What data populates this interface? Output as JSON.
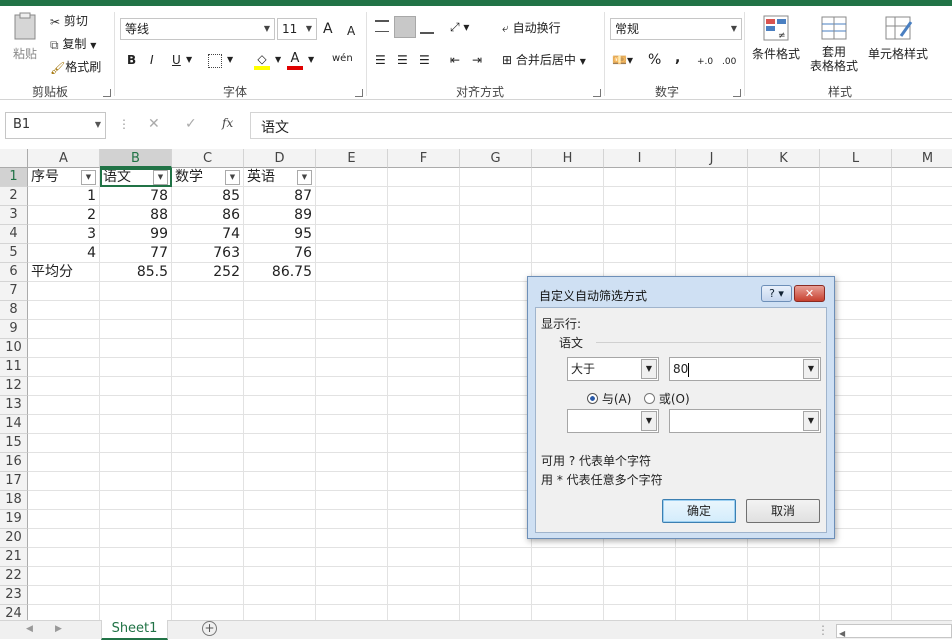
{
  "ribbon": {
    "clipboard": {
      "paste": "粘贴",
      "cut": "剪切",
      "copy": "复制",
      "format_painter": "格式刷",
      "group": "剪贴板"
    },
    "font": {
      "name": "等线",
      "size": "11",
      "bold": "B",
      "italic": "I",
      "underline": "U",
      "group": "字体",
      "grow": "A",
      "shrink": "A",
      "phonetic": "wén"
    },
    "alignment": {
      "wrap": "自动换行",
      "merge": "合并后居中",
      "group": "对齐方式"
    },
    "number": {
      "format": "常规",
      "percent": "%",
      "comma": ",",
      "group": "数字",
      "inc": "+.0",
      "dec": ".00"
    },
    "styles": {
      "conditional": "条件格式",
      "table": "套用",
      "table2": "表格格式",
      "cell": "单元格样式",
      "group": "样式"
    }
  },
  "formula_bar": {
    "name_box": "B1",
    "fx": "fx",
    "cancel": "✕",
    "enter": "✓",
    "value": "语文"
  },
  "columns": [
    "A",
    "B",
    "C",
    "D",
    "E",
    "F",
    "G",
    "H",
    "I",
    "J",
    "K",
    "L",
    "M"
  ],
  "rows": [
    "1",
    "2",
    "3",
    "4",
    "5",
    "6",
    "7",
    "8",
    "9",
    "10",
    "11",
    "12",
    "13",
    "14",
    "15",
    "16",
    "17",
    "18",
    "19",
    "20",
    "21",
    "22",
    "23",
    "24"
  ],
  "cells": {
    "A1": "序号",
    "B1": "语文",
    "C1": "数学",
    "D1": "英语",
    "A2": "1",
    "B2": "78",
    "C2": "85",
    "D2": "87",
    "A3": "2",
    "B3": "88",
    "C3": "86",
    "D3": "89",
    "A4": "3",
    "B4": "99",
    "C4": "74",
    "D4": "95",
    "A5": "4",
    "B5": "77",
    "C5": "763",
    "D5": "76",
    "A6": "平均分",
    "B6": "85.5",
    "C6": "252",
    "D6": "86.75"
  },
  "sheet_tab": "Sheet1",
  "dialog": {
    "title": "自定义自动筛选方式",
    "help": "?",
    "show_rows": "显示行:",
    "field": "语文",
    "op1": "大于",
    "val1": "80",
    "and": "与(A)",
    "or": "或(O)",
    "op2": "",
    "val2": "",
    "hint1": "可用 ? 代表单个字符",
    "hint2": "用 * 代表任意多个字符",
    "ok": "确定",
    "cancel": "取消"
  }
}
